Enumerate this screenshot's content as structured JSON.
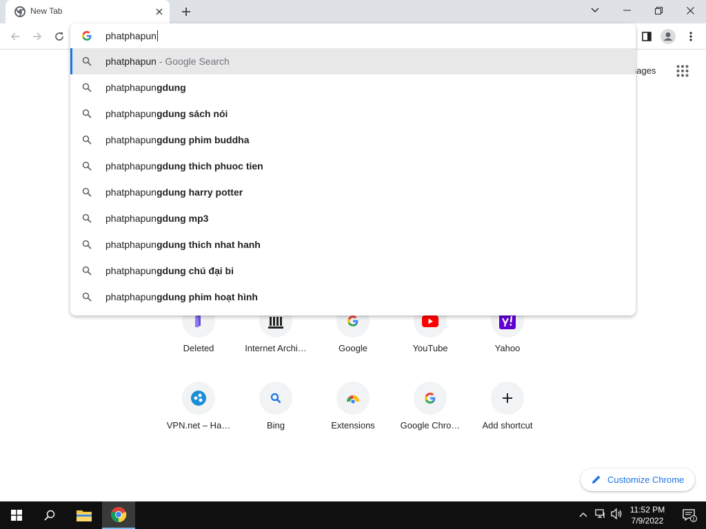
{
  "browser": {
    "tab": {
      "title": "New Tab"
    },
    "omnibox": {
      "value": "phatphapun"
    },
    "suggestions": [
      {
        "typed": "phatphapun",
        "completion": "",
        "hint": " - Google Search",
        "selected": true
      },
      {
        "typed": "phatphapun",
        "completion": "gdung"
      },
      {
        "typed": "phatphapun",
        "completion": "gdung sách nói"
      },
      {
        "typed": "phatphapun",
        "completion": "gdung phim buddha"
      },
      {
        "typed": "phatphapun",
        "completion": "gdung thich phuoc tien"
      },
      {
        "typed": "phatphapun",
        "completion": "gdung harry potter"
      },
      {
        "typed": "phatphapun",
        "completion": "gdung mp3"
      },
      {
        "typed": "phatphapun",
        "completion": "gdung thich nhat hanh"
      },
      {
        "typed": "phatphapun",
        "completion": "gdung chú đại bi"
      },
      {
        "typed": "phatphapun",
        "completion": "gdung phim hoạt hình"
      }
    ]
  },
  "ntp": {
    "images_link": "nages",
    "shortcuts": [
      {
        "label": "Deleted",
        "icon": "deleted-site-icon"
      },
      {
        "label": "Internet Archi…",
        "icon": "internet-archive-icon"
      },
      {
        "label": "Google",
        "icon": "google-icon"
      },
      {
        "label": "YouTube",
        "icon": "youtube-icon"
      },
      {
        "label": "Yahoo",
        "icon": "yahoo-icon"
      },
      {
        "label": "VPN.net – Ha…",
        "icon": "vpn-icon"
      },
      {
        "label": "Bing",
        "icon": "bing-search-icon"
      },
      {
        "label": "Extensions",
        "icon": "extensions-icon"
      },
      {
        "label": "Google Chro…",
        "icon": "google-icon"
      },
      {
        "label": "Add shortcut",
        "icon": "plus-icon"
      }
    ],
    "customize_label": "Customize Chrome"
  },
  "taskbar": {
    "time": "11:52 PM",
    "date": "7/9/2022",
    "notification_count": "1"
  },
  "colors": {
    "accent": "#1a73e8",
    "tabstrip": "#dee1e6",
    "taskbar": "#101010"
  }
}
